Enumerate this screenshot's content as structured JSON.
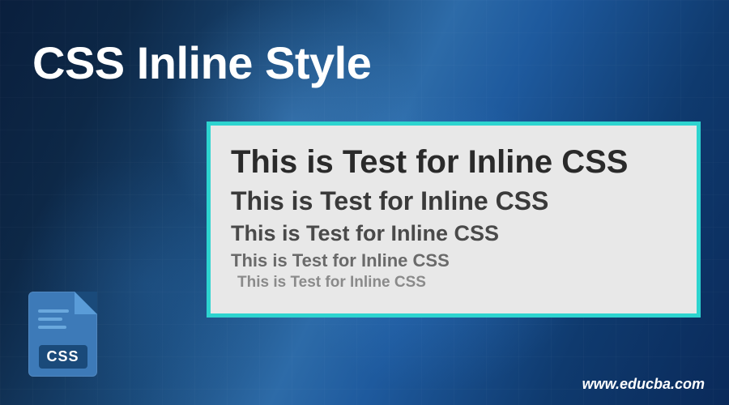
{
  "title": "CSS Inline Style",
  "example": {
    "text": "This is Test for Inline CSS"
  },
  "icon": {
    "label": "CSS"
  },
  "footer": {
    "url": "www.educba.com"
  }
}
